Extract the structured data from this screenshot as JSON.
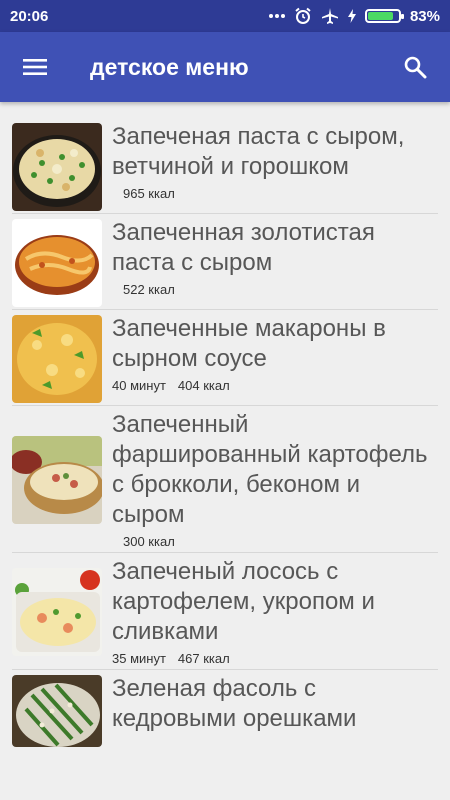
{
  "status_bar": {
    "time": "20:06",
    "battery_percent": "83%",
    "battery_level": 0.83,
    "icons": [
      "dots-icon",
      "alarm-icon",
      "airplane-icon",
      "charging-icon",
      "battery-icon"
    ]
  },
  "app_bar": {
    "title": "детское меню",
    "menu_icon": "hamburger-menu-icon",
    "search_icon": "search-icon",
    "color": "#3f51b5"
  },
  "recipes": [
    {
      "title": "Запеченая паста с сыром, ветчиной и горошком",
      "time": "",
      "kcal": "965 ккал"
    },
    {
      "title": "Запеченная золотистая паста с сыром",
      "time": "",
      "kcal": "522 ккал"
    },
    {
      "title": "Запеченные макароны в сырном соусе",
      "time": "40 минут",
      "kcal": "404 ккал"
    },
    {
      "title": "Запеченный фаршированный картофель с брокколи, беконом и сыром",
      "time": "",
      "kcal": "300 ккал"
    },
    {
      "title": "Запеченый лосось с картофелем, укропом и сливками",
      "time": "35 минут",
      "kcal": "467 ккал"
    },
    {
      "title": "Зеленая фасоль с кедровыми орешками",
      "time": "",
      "kcal": ""
    }
  ]
}
